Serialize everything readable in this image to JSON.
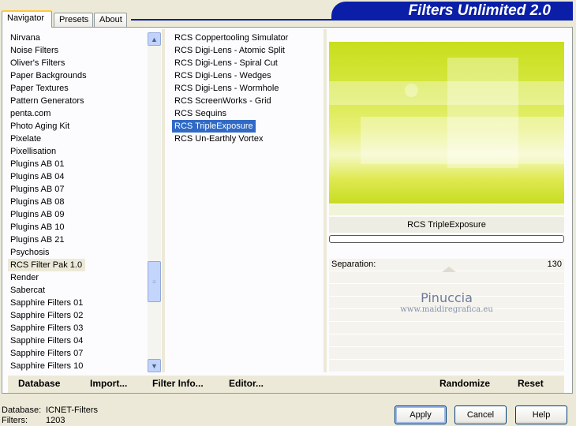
{
  "tabs": [
    "Navigator",
    "Presets",
    "About"
  ],
  "banner_title": "Filters Unlimited 2.0",
  "categories": [
    "Nirvana",
    "Noise Filters",
    "Oliver's Filters",
    "Paper Backgrounds",
    "Paper Textures",
    "Pattern Generators",
    "penta.com",
    "Photo Aging Kit",
    "Pixelate",
    "Pixellisation",
    "Plugins AB 01",
    "Plugins AB 04",
    "Plugins AB 07",
    "Plugins AB 08",
    "Plugins AB 09",
    "Plugins AB 10",
    "Plugins AB 21",
    "Psychosis",
    "RCS Filter Pak 1.0",
    "Render",
    "Sabercat",
    "Sapphire Filters 01",
    "Sapphire Filters 02",
    "Sapphire Filters 03",
    "Sapphire Filters 04",
    "Sapphire Filters 07",
    "Sapphire Filters 10"
  ],
  "selected_category": "RCS Filter Pak 1.0",
  "filters": [
    "RCS Coppertooling Simulator",
    "RCS Digi-Lens - Atomic Split",
    "RCS Digi-Lens - Spiral Cut",
    "RCS Digi-Lens - Wedges",
    "RCS Digi-Lens - Wormhole",
    "RCS ScreenWorks - Grid",
    "RCS Sequins",
    "RCS TripleExposure",
    "RCS Un-Earthly Vortex"
  ],
  "selected_filter": "RCS TripleExposure",
  "preview_filter_name": "RCS TripleExposure",
  "control": {
    "label": "Separation:",
    "value": "130"
  },
  "watermark": {
    "line1": "Pinuccia",
    "line2": "www.maidiregrafica.eu"
  },
  "bottom_buttons": {
    "database": "Database",
    "import": "Import...",
    "filter_info": "Filter Info...",
    "editor": "Editor...",
    "randomize": "Randomize",
    "reset": "Reset"
  },
  "footer": {
    "database_label": "Database:",
    "database_value": "ICNET-Filters",
    "filters_label": "Filters:",
    "filters_value": "1203"
  },
  "dialog_buttons": {
    "apply": "Apply",
    "cancel": "Cancel",
    "help": "Help"
  },
  "colors": {
    "banner": "#0a1ea8",
    "selection": "#316ac5",
    "preview": "#c8de1c"
  }
}
